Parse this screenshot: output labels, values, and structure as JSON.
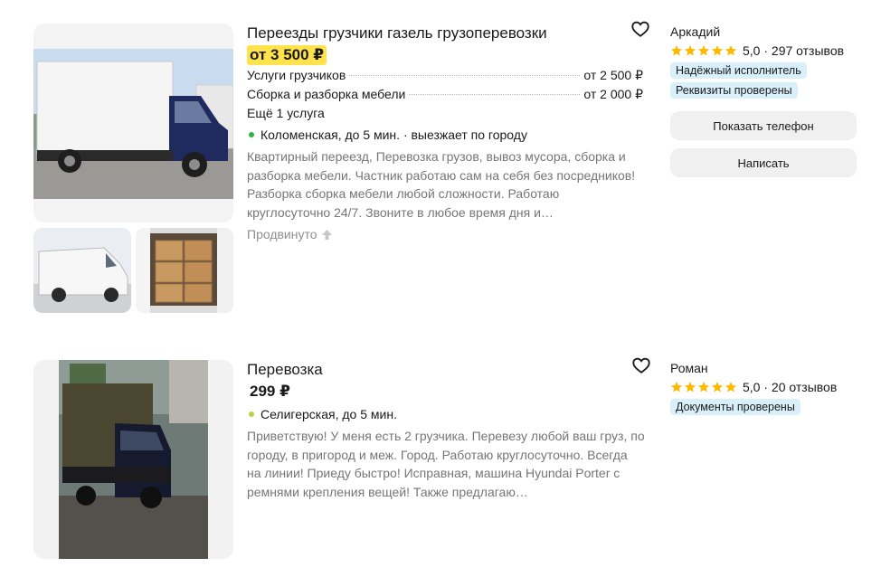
{
  "theme": {
    "price_highlight": "#ffe34d",
    "badge_bg": "#d9f0fb",
    "badge_text": "#1a1a1a",
    "star_color": "#ffb800",
    "metro_kolomenskaya": "#2db34a",
    "metro_seligerskaya": "#b4d445",
    "muted_text": "#767676"
  },
  "listings": [
    {
      "title": "Переезды грузчики газель грузоперевозки",
      "price": "от 3 500 ₽",
      "price_highlighted": true,
      "services": [
        {
          "name": "Услуги грузчиков",
          "price": "от 2 500 ₽"
        },
        {
          "name": "Сборка и разборка мебели",
          "price": "от 2 000 ₽"
        }
      ],
      "more_services": "Ещё 1 услуга",
      "location": "Коломенская, до 5 мин. · выезжает по городу",
      "description": "Квартирный переезд, Перевозка грузов, вывоз мусора, сборка и разборка мебели. Частник работаю сам на себя без посредников! Разборка сборка мебели любой сложности. Работаю круглосуточно 24/7. Звоните в любое время дня и…",
      "promoted": "Продвинуто",
      "favorite_icon": "heart-outline-icon",
      "seller": {
        "name": "Аркадий",
        "rating": "5,0",
        "stars": 5,
        "reviews": "297 отзывов",
        "badges": [
          "Надёжный исполнитель",
          "Реквизиты проверены"
        ]
      },
      "buttons": {
        "phone": "Показать телефон",
        "write": "Написать"
      }
    },
    {
      "title": "Перевозка",
      "price": "299 ₽",
      "price_highlighted": false,
      "location": "Селигерская, до 5 мин.",
      "description": "Приветствую! У меня есть 2 грузчика. Перевезу любой ваш груз, по городу, в пригород и меж. Город. Работаю круглосуточно. Всегда на линии! Приеду быстро! Исправная, машина Hyundai Porter с ремнями крепления вещей! Также предлагаю…",
      "favorite_icon": "heart-outline-icon",
      "seller": {
        "name": "Роман",
        "rating": "5,0",
        "stars": 5,
        "reviews": "20 отзывов",
        "badges": [
          "Документы проверены"
        ]
      }
    }
  ]
}
